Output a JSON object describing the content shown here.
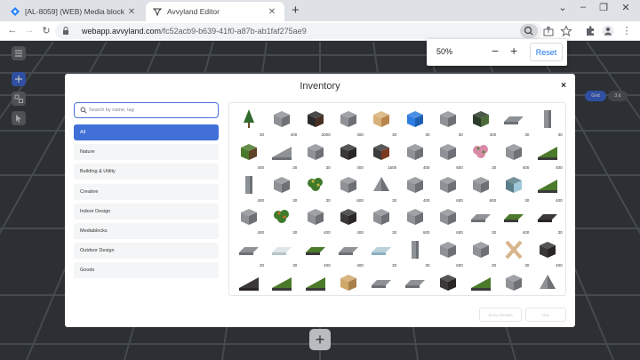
{
  "browser": {
    "tabs": [
      {
        "title": "[AL-8059] (WEB) Media block -->",
        "icon": "jira-icon",
        "active": false
      },
      {
        "title": "Avvyland Editor",
        "icon": "avvyland-icon",
        "active": true
      }
    ],
    "url_host": "webapp.avvyland.com",
    "url_path": "/fc52acb9-b639-41f0-a87b-ab1faf275ae9",
    "zoom": {
      "value": "50%",
      "minus": "−",
      "plus": "+",
      "reset_label": "Reset"
    }
  },
  "editor": {
    "grid_label": "Grid",
    "mode_label": "3 d",
    "add_label": "+"
  },
  "inventory": {
    "title": "Inventory",
    "close": "×",
    "search_placeholder": "Search by name, tag",
    "categories": [
      "All",
      "Nature",
      "Building & Utility",
      "Creative",
      "Indoor Design",
      "Mediablocks",
      "Outdoor Design",
      "Goods"
    ],
    "active_category": "All",
    "items": [
      {
        "qty": "30",
        "kind": "tree"
      },
      {
        "qty": "400",
        "kind": "concrete"
      },
      {
        "qty": "2000",
        "kind": "dark"
      },
      {
        "qty": "400",
        "kind": "brick-hole"
      },
      {
        "qty": "30",
        "kind": "wood"
      },
      {
        "qty": "30",
        "kind": "blue"
      },
      {
        "qty": "30",
        "kind": "corner"
      },
      {
        "qty": "400",
        "kind": "mossy"
      },
      {
        "qty": "30",
        "kind": "slab"
      },
      {
        "qty": "30",
        "kind": "post"
      },
      {
        "qty": "400",
        "kind": "grass"
      },
      {
        "qty": "30",
        "kind": "wedge"
      },
      {
        "qty": "30",
        "kind": "stone"
      },
      {
        "qty": "400",
        "kind": "dark-stone"
      },
      {
        "qty": "1600",
        "kind": "rust"
      },
      {
        "qty": "400",
        "kind": "block"
      },
      {
        "qty": "600",
        "kind": "rock"
      },
      {
        "qty": "30",
        "kind": "flowers"
      },
      {
        "qty": "400",
        "kind": "block2"
      },
      {
        "qty": "400",
        "kind": "grass-ramp"
      },
      {
        "qty": "400",
        "kind": "pillar"
      },
      {
        "qty": "30",
        "kind": "bench"
      },
      {
        "qty": "30",
        "kind": "plant"
      },
      {
        "qty": "600",
        "kind": "boulder"
      },
      {
        "qty": "30",
        "kind": "pyramid"
      },
      {
        "qty": "400",
        "kind": "steps"
      },
      {
        "qty": "600",
        "kind": "cube"
      },
      {
        "qty": "600",
        "kind": "rock2"
      },
      {
        "qty": "30",
        "kind": "crystal"
      },
      {
        "qty": "400",
        "kind": "moss-ramp"
      },
      {
        "qty": "400",
        "kind": "wall"
      },
      {
        "qty": "30",
        "kind": "bush"
      },
      {
        "qty": "400",
        "kind": "bricks"
      },
      {
        "qty": "400",
        "kind": "dark-corner"
      },
      {
        "qty": "30",
        "kind": "rubble"
      },
      {
        "qty": "600",
        "kind": "stone2"
      },
      {
        "qty": "600",
        "kind": "ball"
      },
      {
        "qty": "30",
        "kind": "beam"
      },
      {
        "qty": "400",
        "kind": "grass-slab"
      },
      {
        "qty": "30",
        "kind": "dark-slab"
      },
      {
        "qty": "30",
        "kind": "thin-wall"
      },
      {
        "qty": "30",
        "kind": "glass"
      },
      {
        "qty": "400",
        "kind": "grass-strip"
      },
      {
        "qty": "400",
        "kind": "stick"
      },
      {
        "qty": "30",
        "kind": "water"
      },
      {
        "qty": "30",
        "kind": "column"
      },
      {
        "qty": "600",
        "kind": "stone3"
      },
      {
        "qty": "30",
        "kind": "stone4"
      },
      {
        "qty": "30",
        "kind": "cross"
      },
      {
        "qty": "400",
        "kind": "dark-step"
      },
      {
        "qty": "30",
        "kind": "dark-ramp"
      },
      {
        "qty": "400",
        "kind": "grass-edge"
      },
      {
        "qty": "400",
        "kind": "grass-ramp2"
      },
      {
        "qty": "30",
        "kind": "crate"
      },
      {
        "qty": "30",
        "kind": "beam2"
      },
      {
        "qty": "30",
        "kind": "trough"
      },
      {
        "qty": "400",
        "kind": "dark-cube"
      },
      {
        "qty": "30",
        "kind": "grass-ramp3"
      },
      {
        "qty": "600",
        "kind": "stone5"
      },
      {
        "qty": "30",
        "kind": "pyramid2"
      }
    ],
    "buttons": {
      "secondary": "Show Results",
      "primary": "Use"
    }
  }
}
